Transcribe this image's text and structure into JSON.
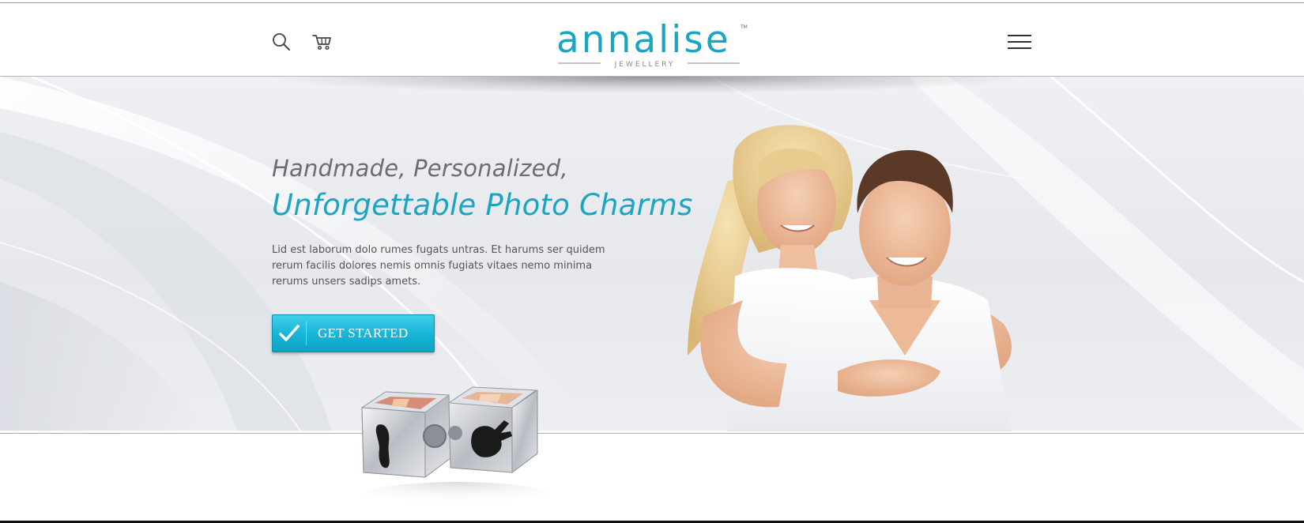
{
  "header": {
    "logo": {
      "wordmark": "annalise",
      "tagline": "JEWELLERY",
      "trademark": "TM"
    },
    "icons": {
      "search": "search-icon",
      "cart": "cart-icon",
      "menu": "hamburger-menu-icon"
    }
  },
  "hero": {
    "headline_line1": "Handmade, Personalized,",
    "headline_line2": "Unforgettable Photo Charms",
    "body": "Lid est laborum dolo rumes fugats untras. Et harums ser quidem rerum facilis dolores nemis omnis fugiats vitaes nemo minima rerums unsers sadips amets.",
    "cta": {
      "label": "GET STARTED",
      "icon": "checkmark-icon"
    }
  },
  "colors": {
    "brand": "#1aa6c3",
    "button_top": "#3fd0ea",
    "button_bottom": "#0ea2c3",
    "headline_gray": "#6d6d6d",
    "body_text": "#555555"
  }
}
